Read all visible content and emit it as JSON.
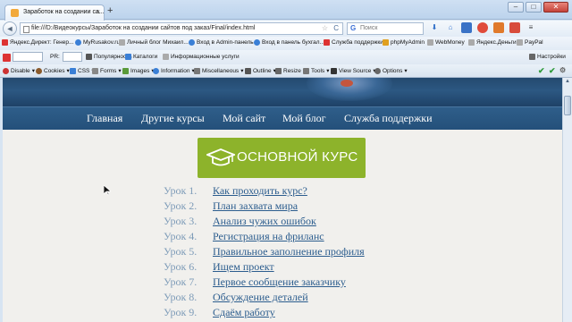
{
  "browser": {
    "tab_title": "Заработок на создании са...",
    "tab_close": "×",
    "new_tab": "+",
    "url": "file:///D:/Видеокурсы/Заработок на создании сайтов под заказ/Final/index.html",
    "search_placeholder": "Поиск",
    "window_buttons": {
      "minimize": "–",
      "maximize": "□",
      "close": "✕"
    },
    "back_icon": "◄",
    "reload_icon": "C",
    "star_icon": "☆"
  },
  "bookmarks": [
    "Яндекс.Директ: Генер...",
    "MyRusakov.ru",
    "Личный блог Михаил...",
    "Вход в Admin-панель",
    "Вход в панель бухгал...",
    "Служба поддержки",
    "phpMyAdmin",
    "WebMoney",
    "Яндекс.Деньги",
    "PayPal"
  ],
  "seo_toolbar": {
    "yandex_box": "",
    "pr_label": "PR:",
    "items": [
      "Популярность",
      "Каталоги",
      "Информационные услуги"
    ],
    "settings": "Настройки"
  },
  "webdev_toolbar": {
    "items": [
      "Disable",
      "Cookies",
      "CSS",
      "Forms",
      "Images",
      "Information",
      "Miscellaneous",
      "Outline",
      "Resize",
      "Tools",
      "View Source",
      "Options"
    ]
  },
  "site": {
    "menu": [
      "Главная",
      "Другие курсы",
      "Мой сайт",
      "Мой блог",
      "Служба поддержки"
    ],
    "main_button": "ОСНОВНОЙ КУРС",
    "lessons": [
      {
        "num": "Урок 1.",
        "title": "Как проходить курс?"
      },
      {
        "num": "Урок 2.",
        "title": "План захвата мира"
      },
      {
        "num": "Урок 3.",
        "title": "Анализ чужих ошибок"
      },
      {
        "num": "Урок 4.",
        "title": "Регистрация на фриланс"
      },
      {
        "num": "Урок 5.",
        "title": "Правильное заполнение профиля"
      },
      {
        "num": "Урок 6.",
        "title": "Ищем проект"
      },
      {
        "num": "Урок 7.",
        "title": "Первое сообщение заказчику"
      },
      {
        "num": "Урок 8.",
        "title": "Обсуждение деталей"
      },
      {
        "num": "Урок 9.",
        "title": "Сдаём работу"
      }
    ]
  },
  "colors": {
    "menu_bg": "#2a5882",
    "button_green": "#8db32b",
    "lesson_link": "#2c5d8e",
    "lesson_number": "#7d9bb8",
    "page_bg": "#f1f0ed"
  }
}
